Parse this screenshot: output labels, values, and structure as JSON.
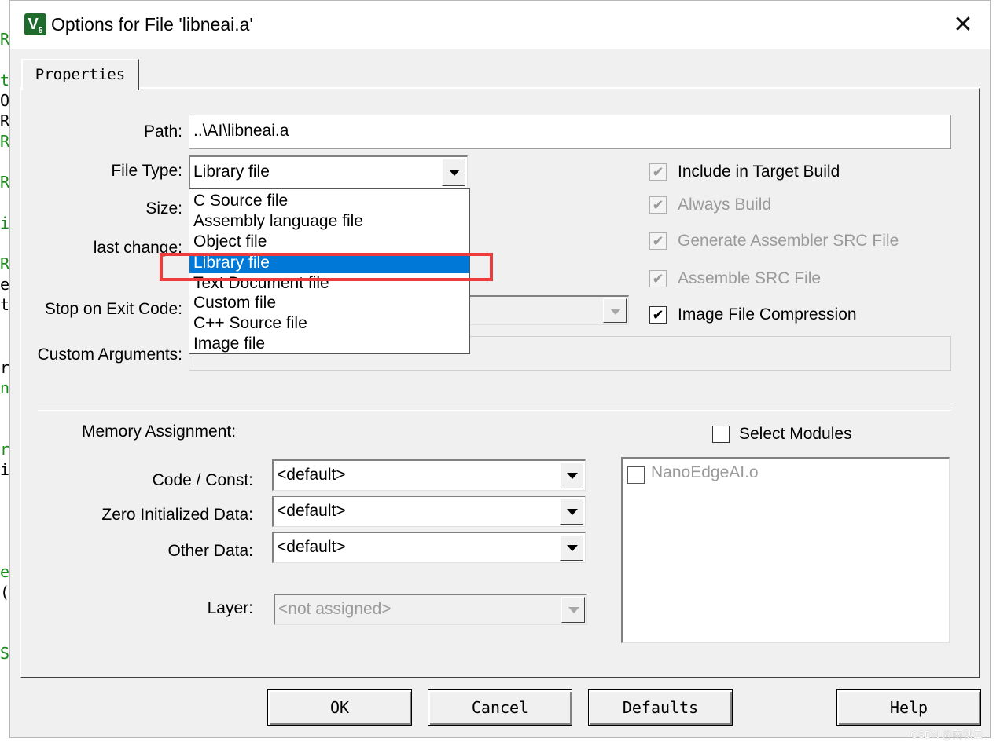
{
  "window": {
    "title": "Options for File 'libneai.a'",
    "close_glyph": "✕"
  },
  "tabs": [
    {
      "label": "Properties"
    }
  ],
  "fields": {
    "path_label": "Path:",
    "path_value": "..\\AI\\libneai.a",
    "file_type_label": "File Type:",
    "file_type_value": "Library file",
    "size_label": "Size:",
    "last_change_label": "last change:",
    "stop_on_exit_label": "Stop on Exit Code:",
    "custom_args_label": "Custom Arguments:"
  },
  "file_type_options": [
    {
      "label": "C Source file",
      "selected": false
    },
    {
      "label": "Assembly language file",
      "selected": false
    },
    {
      "label": "Object file",
      "selected": false
    },
    {
      "label": "Library file",
      "selected": true
    },
    {
      "label": "Text Document file",
      "selected": false
    },
    {
      "label": "Custom file",
      "selected": false
    },
    {
      "label": "C++ Source file",
      "selected": false
    },
    {
      "label": "Image file",
      "selected": false
    }
  ],
  "options": [
    {
      "label": "Include in Target Build",
      "checked": true,
      "enabled": false
    },
    {
      "label": "Always Build",
      "checked": true,
      "enabled": false
    },
    {
      "label": "Generate Assembler SRC File",
      "checked": true,
      "enabled": false
    },
    {
      "label": "Assemble SRC File",
      "checked": true,
      "enabled": false
    },
    {
      "label": "Image File Compression",
      "checked": true,
      "enabled": true
    }
  ],
  "memory": {
    "heading": "Memory Assignment:",
    "code_const_label": "Code / Const:",
    "code_const_value": "<default>",
    "zero_init_label": "Zero Initialized Data:",
    "zero_init_value": "<default>",
    "other_data_label": "Other Data:",
    "other_data_value": "<default>",
    "layer_label": "Layer:",
    "layer_value": "<not assigned>"
  },
  "modules": {
    "select_label": "Select Modules",
    "select_checked": false,
    "items": [
      {
        "label": "NanoEdgeAI.o",
        "checked": false
      }
    ]
  },
  "buttons": {
    "ok": "OK",
    "cancel": "Cancel",
    "defaults": "Defaults",
    "help": "Help"
  },
  "app_icon_text": "V",
  "app_icon_sub": "5",
  "checkmark_glyph": "✔",
  "colors": {
    "selection": "#0078d7",
    "highlight_box": "#ef3b3b",
    "disabled_text": "#9a9a9a"
  },
  "watermark": "CSDN @南秋云"
}
